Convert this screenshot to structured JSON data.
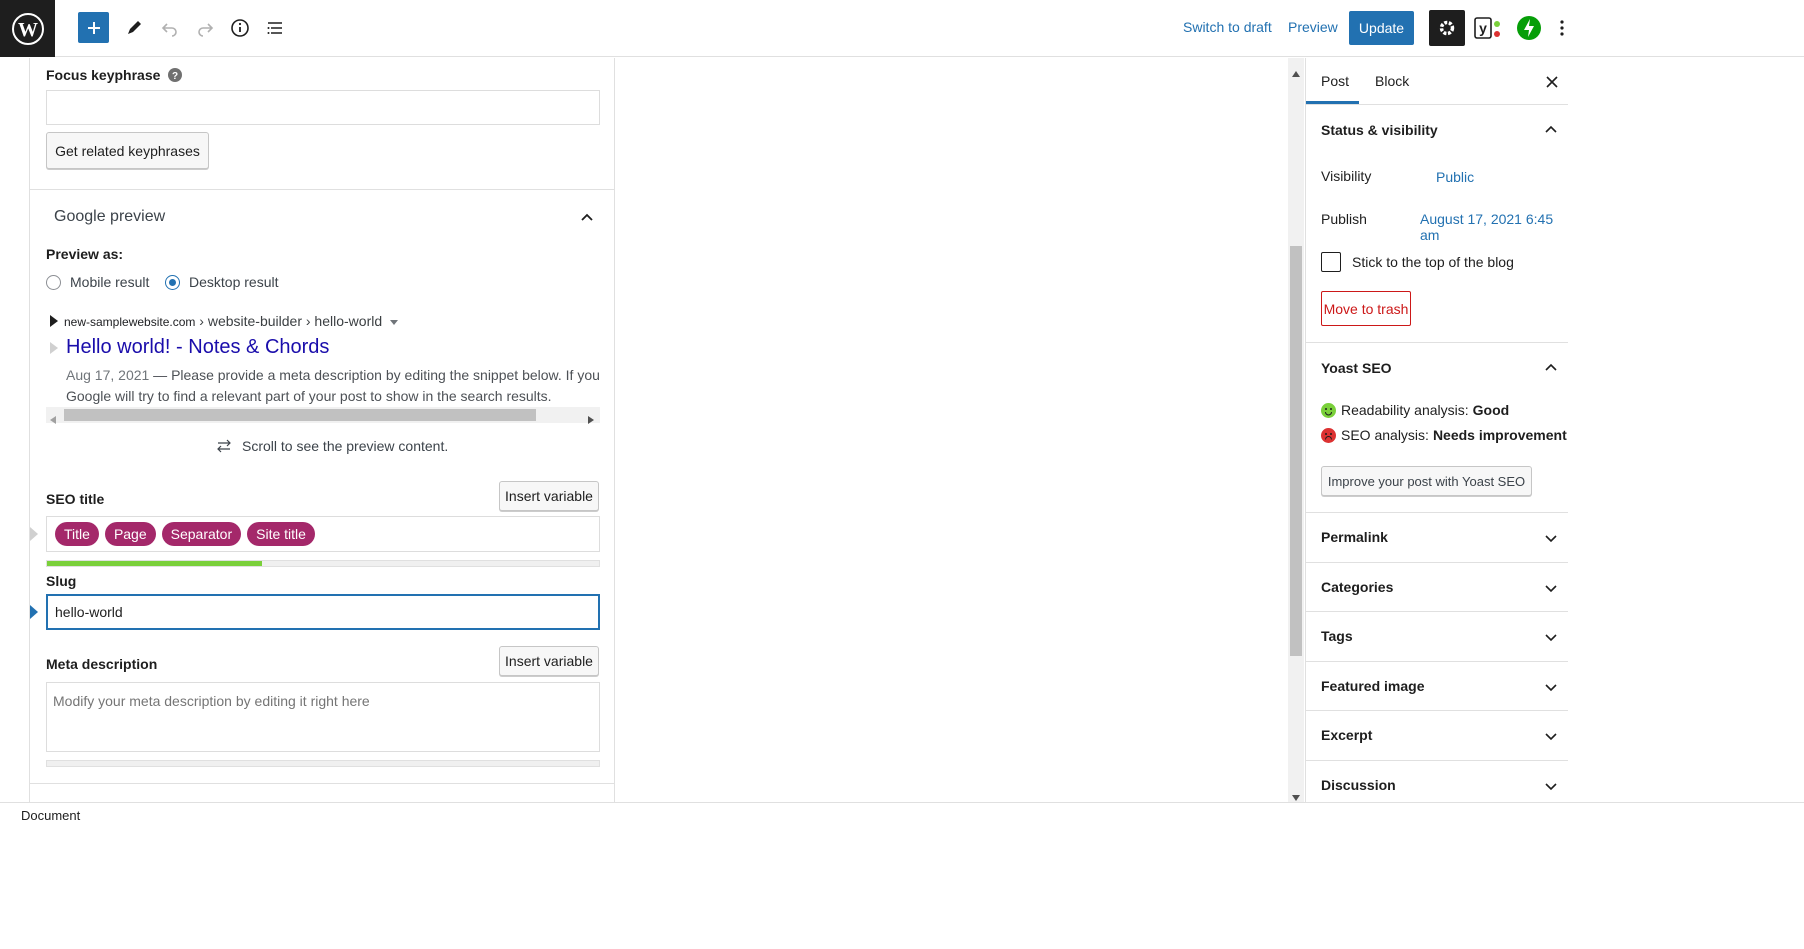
{
  "toolbar": {
    "switch_to_draft": "Switch to draft",
    "preview": "Preview",
    "update": "Update"
  },
  "focus": {
    "label": "Focus keyphrase",
    "value": "",
    "related_btn": "Get related keyphrases"
  },
  "google_preview": {
    "title": "Google preview",
    "preview_as": "Preview as:",
    "mobile": "Mobile result",
    "desktop": "Desktop result",
    "selected": "desktop",
    "breadcrumb_domain": "new-samplewebsite.com",
    "breadcrumb_path": " › website-builder › hello-world",
    "link_title": "Hello world! - Notes & Chords",
    "date": "Aug 17, 2021",
    "snippet_line1": " — Please provide a meta description by editing the snippet below. If you d",
    "snippet_line2": "Google will try to find a relevant part of your post to show in the search results.",
    "scroll_hint": "Scroll to see the preview content."
  },
  "seo_title": {
    "label": "SEO title",
    "insert_btn": "Insert variable",
    "pills": [
      "Title",
      "Page",
      "Separator",
      "Site title"
    ],
    "progress": 0.39,
    "progress_color": "#7ad03a"
  },
  "slug": {
    "label": "Slug",
    "value": "hello-world"
  },
  "meta": {
    "label": "Meta description",
    "insert_btn": "Insert variable",
    "placeholder": "Modify your meta description by editing it right here"
  },
  "sidebar": {
    "tab_post": "Post",
    "tab_block": "Block",
    "status": {
      "title": "Status & visibility",
      "visibility_label": "Visibility",
      "visibility_value": "Public",
      "publish_label": "Publish",
      "publish_value": "August 17, 2021 6:45 am",
      "sticky_label": "Stick to the top of the blog",
      "trash": "Move to trash"
    },
    "yoast": {
      "title": "Yoast SEO",
      "readability_label": "Readability analysis: ",
      "readability_value": "Good",
      "seo_label": "SEO analysis: ",
      "seo_value": "Needs improvement",
      "improve_btn": "Improve your post with Yoast SEO"
    },
    "panels": [
      "Permalink",
      "Categories",
      "Tags",
      "Featured image",
      "Excerpt",
      "Discussion"
    ]
  },
  "statusbar": {
    "label": "Document"
  },
  "colors": {
    "accent": "#2271b1",
    "pill": "#a4286a",
    "good": "#7ad03a",
    "bad": "#dc3232",
    "trash": "#cc1818"
  }
}
